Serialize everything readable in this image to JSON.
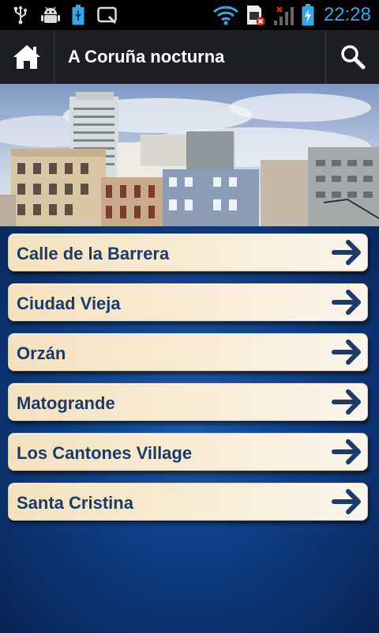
{
  "status_bar": {
    "time": "22:28",
    "icons": [
      "usb-icon",
      "android-debug-icon",
      "battery-usb-icon",
      "notification-icon",
      "wifi-icon",
      "sim-error-icon",
      "signal-icon",
      "battery-charging-icon"
    ]
  },
  "action_bar": {
    "title": "A Coruña nocturna",
    "home_icon": "home-icon",
    "search_icon": "search-icon"
  },
  "list": {
    "items": [
      {
        "label": "Calle de la Barrera"
      },
      {
        "label": "Ciudad Vieja"
      },
      {
        "label": "Orzán"
      },
      {
        "label": "Matogrande"
      },
      {
        "label": "Los Cantones Village"
      },
      {
        "label": "Santa Cristina"
      }
    ]
  },
  "colors": {
    "accent": "#35a7e8",
    "actionbar_bg": "#1e1f22",
    "item_text": "#1d3b66",
    "background_blue": "#0f3f86"
  }
}
